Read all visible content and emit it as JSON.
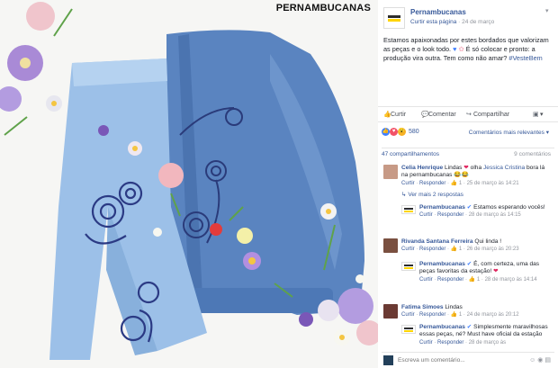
{
  "photo": {
    "brand": "PERNAMBUCANAS"
  },
  "post": {
    "page_name": "Pernambucanas",
    "follow_label": "Curtir esta página",
    "separator": " · ",
    "date": "24 de março",
    "text_line": "Estamos apaixonadas por estes bordados que valorizam as peças e o look todo.",
    "text_line2": "É só colocar e pronto: a produção vira outra. Tem como não amar?",
    "hashtag": "#VesteBem"
  },
  "actions": {
    "like": "Curtir",
    "comment": "Comentar",
    "share": "Compartilhar"
  },
  "reactions": {
    "count": "580",
    "sort_label": "Comentários mais relevantes ▾",
    "colors": {
      "like": "#4080ff",
      "love": "#f25268",
      "wow": "#f7b125"
    }
  },
  "stats": {
    "shares": "47 compartilhamentos",
    "comments": "9 comentários"
  },
  "comments": [
    {
      "name": "Celia Henrique",
      "text_a": "Lindas",
      "text_b": "olha",
      "mention": "Jessica Cristina",
      "text_c": "bora lá na pernambucanas 😂😂",
      "like": "Curtir",
      "reply": "Responder",
      "likes": "1",
      "time": "25 de março às 14:21",
      "more_replies": "↳ Ver mais 2 respostas"
    },
    {
      "name": "Rivanda Santana Ferreira",
      "text": "Qui linda !",
      "like": "Curtir",
      "reply": "Responder",
      "likes": "1",
      "time": "26 de março às 20:23"
    },
    {
      "name": "Fatima Simoes",
      "text": "Lindas",
      "like": "Curtir",
      "reply": "Responder",
      "likes": "1",
      "time": "24 de março às 20:12"
    }
  ],
  "replies": [
    {
      "name": "Pernambucanas",
      "text": "Estamos esperando vocês!",
      "like": "Curtir",
      "reply": "Responder",
      "time": "28 de março às 14:15"
    },
    {
      "name": "Pernambucanas",
      "text": "É, com certeza, uma das peças favoritas da estação!",
      "like": "Curtir",
      "reply": "Responder",
      "likes": "1",
      "time": "28 de março às 14:14"
    },
    {
      "name": "Pernambucanas",
      "text": "Simplesmente maravilhosas essas peças, né? Must have oficial da estação",
      "like": "Curtir",
      "reply": "Responder",
      "time": "28 de março às"
    }
  ],
  "comment_box": {
    "placeholder": "Escreva um comentário..."
  }
}
